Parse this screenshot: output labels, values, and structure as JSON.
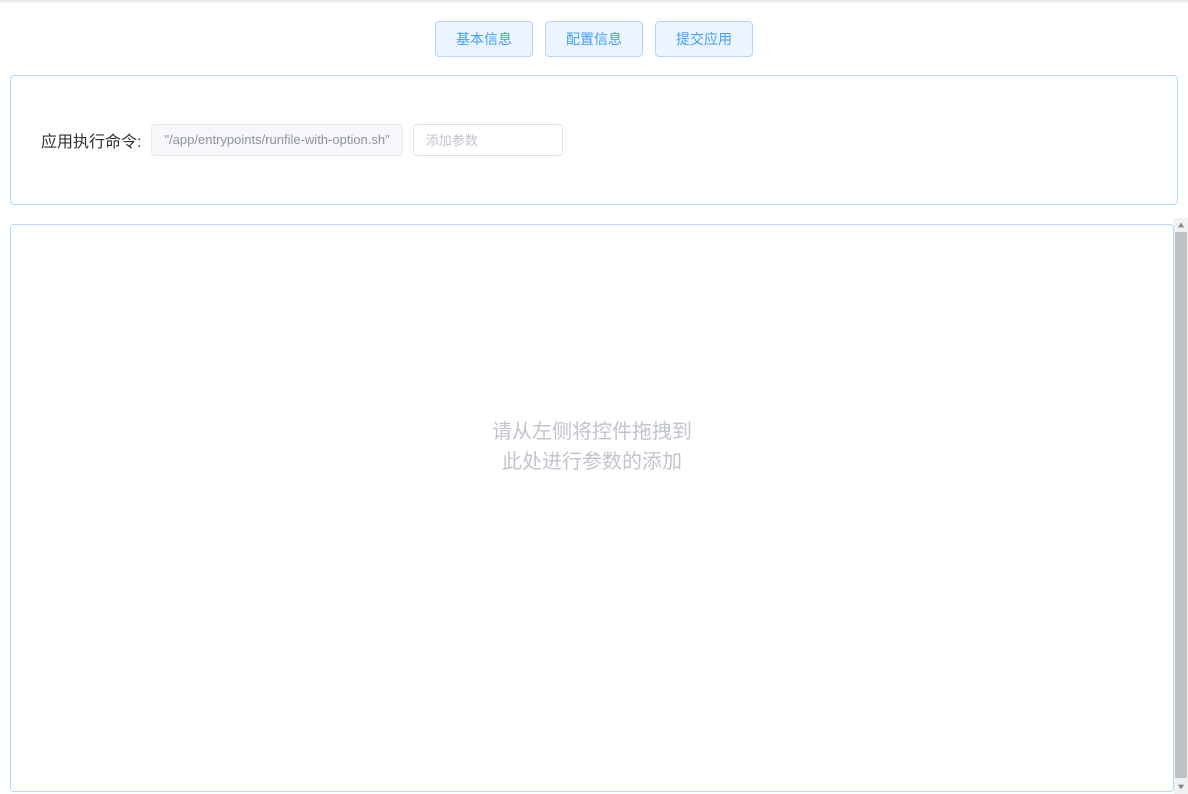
{
  "tabs": {
    "basic": "基本信息",
    "config": "配置信息",
    "submit": "提交应用"
  },
  "command": {
    "label": "应用执行命令:",
    "value": "\"/app/entrypoints/runfile-with-option.sh\"",
    "param_placeholder": "添加参数"
  },
  "dropzone": {
    "line1": "请从左侧将控件拖拽到",
    "line2": "此处进行参数的添加"
  }
}
